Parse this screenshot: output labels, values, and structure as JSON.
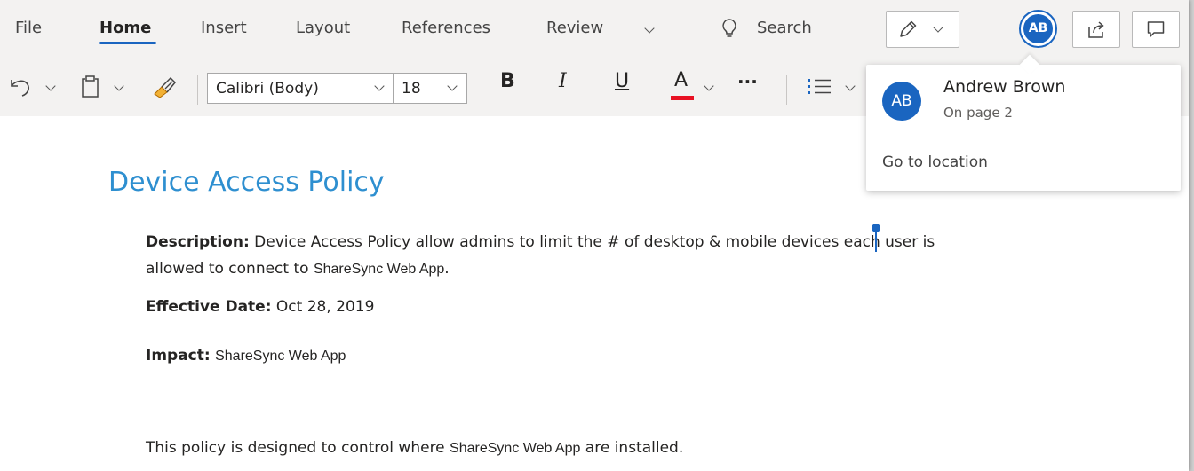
{
  "tabs": [
    {
      "label": "File"
    },
    {
      "label": "Home"
    },
    {
      "label": "Insert"
    },
    {
      "label": "Layout"
    },
    {
      "label": "References"
    },
    {
      "label": "Review"
    }
  ],
  "search": {
    "label": "Search"
  },
  "font": {
    "name": "Calibri (Body)",
    "size": "18"
  },
  "format": {
    "bold": "B",
    "italic": "I",
    "underline": "U",
    "font_color": "A",
    "more": "···"
  },
  "font_color_hex": "#e81123",
  "user": {
    "initials": "AB",
    "name": "Andrew Brown",
    "location": "On page 2",
    "action": "Go to location"
  },
  "document": {
    "title": "Device Access Policy",
    "description_label": "Description:",
    "description_line1": "Device Access Policy allow admins to limit the # of desktop & mobile devices each user is",
    "description_line2_pre": "allowed to connect to ",
    "description_line2_app": "ShareSync Web App",
    "description_line2_post": ".",
    "effective_label": "Effective Date:",
    "effective_value": "Oct 28, 2019",
    "impact_label": "Impact:",
    "impact_value": "ShareSync Web App",
    "policy_pre": "This policy is designed to control where ",
    "policy_app": "ShareSync Web App",
    "policy_post": " are installed."
  },
  "colors": {
    "accent": "#1a65c0",
    "title": "#2e8fd0"
  },
  "icons": [
    "undo-icon",
    "paste-icon",
    "format-painter-icon",
    "lightbulb-icon",
    "pen-icon",
    "share-icon",
    "comment-icon",
    "bullets-icon"
  ]
}
